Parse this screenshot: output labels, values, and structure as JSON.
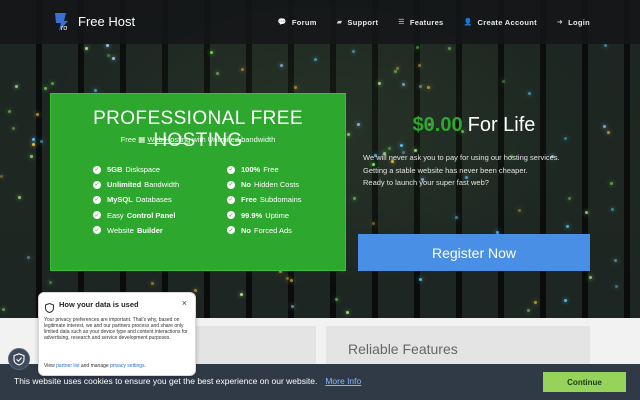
{
  "brand": {
    "name": "Free Host",
    "logo_letter": "ro"
  },
  "nav": {
    "items": [
      {
        "label": "Forum",
        "icon": "comments-icon",
        "glyph": "💬"
      },
      {
        "label": "Support",
        "icon": "book-icon",
        "glyph": "▰"
      },
      {
        "label": "Features",
        "icon": "list-icon",
        "glyph": "☰"
      },
      {
        "label": "Create Account",
        "icon": "user-plus-icon",
        "glyph": "👤"
      },
      {
        "label": "Login",
        "icon": "sign-in-icon",
        "glyph": "➜"
      }
    ]
  },
  "hero": {
    "title": "PROFESSIONAL FREE HOSTING",
    "subtitle_pre": "Free",
    "subtitle_link": "Web Hosting",
    "subtitle_post": "with Unlimited bandwidth",
    "features_left": [
      {
        "bold": "5GB",
        "text": "Diskspace"
      },
      {
        "bold": "Unlimited",
        "text": "Bandwidth"
      },
      {
        "bold": "MySQL",
        "text": "Databases"
      },
      {
        "pre": "Easy",
        "bold": "Control Panel",
        "text": ""
      },
      {
        "pre": "Website",
        "bold": "Builder",
        "text": ""
      }
    ],
    "features_right": [
      {
        "bold": "100%",
        "text": "Free"
      },
      {
        "bold": "No",
        "text": "Hidden Costs"
      },
      {
        "bold": "Free",
        "text": "Subdomains"
      },
      {
        "bold": "99.9%",
        "text": "Uptime"
      },
      {
        "bold": "No",
        "text": "Forced Ads"
      }
    ]
  },
  "pricing": {
    "amount": "$0.00",
    "period": "For Life",
    "description_lines": [
      "We will never ask you to pay for using our hosting services.",
      "Getting a stable website has never been cheaper.",
      "Ready to launch your super fast web?"
    ],
    "register_label": "Register Now"
  },
  "lower": {
    "card_right_title": "Reliable Features"
  },
  "cookie": {
    "text": "This website uses cookies to ensure you get the best experience on our website.",
    "more_info": "More Info",
    "continue_label": "Continue"
  },
  "privacy_popup": {
    "title": "How your data is used",
    "body": "Your privacy preferences are important. That's why, based on legitimate interest, we and our partners process and share only limited data such as your device type and content interactions for advertising, research and service development purposes.",
    "links_pre": "View",
    "link1": "partner list",
    "links_mid": "and manage",
    "link2": "privacy settings",
    "links_post": ".",
    "close": "×"
  },
  "colors": {
    "green": "#2ea72e",
    "blue_button": "#4a8fe6",
    "cookie_bar": "#2f3a46",
    "continue_button": "#95d35a"
  }
}
